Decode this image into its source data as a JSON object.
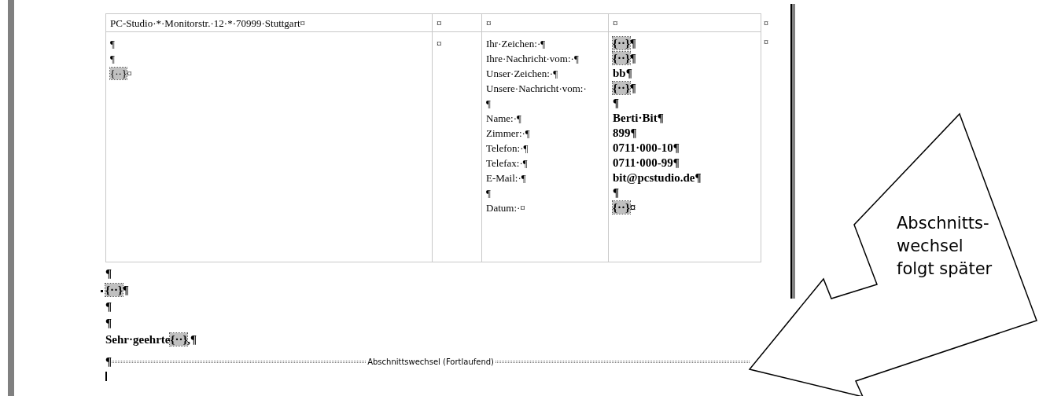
{
  "table": {
    "header_row": [
      "PC-Studio·*·Monitorstr.·12·*·70999·Stuttgart¤",
      "¤",
      "¤",
      "¤"
    ],
    "header_end": "¤",
    "body_columns": [
      [
        [
          {
            "kind": "text",
            "text": "¶"
          }
        ],
        [
          {
            "kind": "text",
            "text": "¶"
          }
        ],
        [
          {
            "kind": "field",
            "text": "{··}"
          },
          {
            "kind": "text",
            "text": "¤"
          }
        ]
      ],
      [
        [
          {
            "kind": "text",
            "text": "¤"
          }
        ]
      ],
      [
        [
          {
            "kind": "text",
            "text": "Ihr·Zeichen:·¶"
          }
        ],
        [
          {
            "kind": "text",
            "text": "Ihre·Nachricht·vom:·¶"
          }
        ],
        [
          {
            "kind": "text",
            "text": "Unser·Zeichen:·¶"
          }
        ],
        [
          {
            "kind": "text",
            "text": "Unsere·Nachricht·vom:·"
          }
        ],
        [
          {
            "kind": "text",
            "text": "¶"
          }
        ],
        [
          {
            "kind": "text",
            "text": "Name:·¶"
          }
        ],
        [
          {
            "kind": "text",
            "text": "Zimmer:·¶"
          }
        ],
        [
          {
            "kind": "text",
            "text": "Telefon:·¶"
          }
        ],
        [
          {
            "kind": "text",
            "text": "Telefax:·¶"
          }
        ],
        [
          {
            "kind": "text",
            "text": "E-Mail:·¶"
          }
        ],
        [
          {
            "kind": "text",
            "text": "¶"
          }
        ],
        [
          {
            "kind": "text",
            "text": "Datum:·¤"
          }
        ]
      ],
      [
        [
          {
            "kind": "field",
            "text": "{··}"
          },
          {
            "kind": "text",
            "text": "¶"
          }
        ],
        [
          {
            "kind": "field",
            "text": "{··}"
          },
          {
            "kind": "text",
            "text": "¶"
          }
        ],
        [
          {
            "kind": "text",
            "text": "bb¶"
          }
        ],
        [
          {
            "kind": "field",
            "text": "{··}"
          },
          {
            "kind": "text",
            "text": "¶"
          }
        ],
        [
          {
            "kind": "text",
            "text": "¶"
          }
        ],
        [
          {
            "kind": "text",
            "text": "Berti·Bit¶"
          }
        ],
        [
          {
            "kind": "text",
            "text": "899¶"
          }
        ],
        [
          {
            "kind": "text",
            "text": "0711·000-10¶"
          }
        ],
        [
          {
            "kind": "text",
            "text": "0711·000-99¶"
          }
        ],
        [
          {
            "kind": "text",
            "text": "bit@pcstudio.de¶"
          }
        ],
        [
          {
            "kind": "text",
            "text": "¶"
          }
        ],
        [
          {
            "kind": "field",
            "text": "{··}"
          },
          {
            "kind": "text",
            "text": "¤"
          }
        ]
      ]
    ],
    "body_end": "¤"
  },
  "paragraphs": [
    {
      "marker": false,
      "parts": [
        {
          "kind": "text",
          "text": "¶"
        }
      ]
    },
    {
      "marker": true,
      "parts": [
        {
          "kind": "field",
          "text": "{··}"
        },
        {
          "kind": "text",
          "text": "¶"
        }
      ]
    },
    {
      "marker": false,
      "parts": [
        {
          "kind": "text",
          "text": "¶"
        }
      ]
    },
    {
      "marker": false,
      "parts": [
        {
          "kind": "text",
          "text": "¶"
        }
      ]
    },
    {
      "marker": false,
      "parts": [
        {
          "kind": "text",
          "text": "Sehr·geehrte"
        },
        {
          "kind": "field",
          "text": "{··}"
        },
        {
          "kind": "text",
          "text": ",¶"
        }
      ]
    }
  ],
  "section_break": {
    "mark": "¶",
    "label": "Abschnittswechsel (Fortlaufend)"
  },
  "callout": {
    "lines": [
      "Abschnitts-",
      "wechsel",
      "folgt später"
    ]
  }
}
